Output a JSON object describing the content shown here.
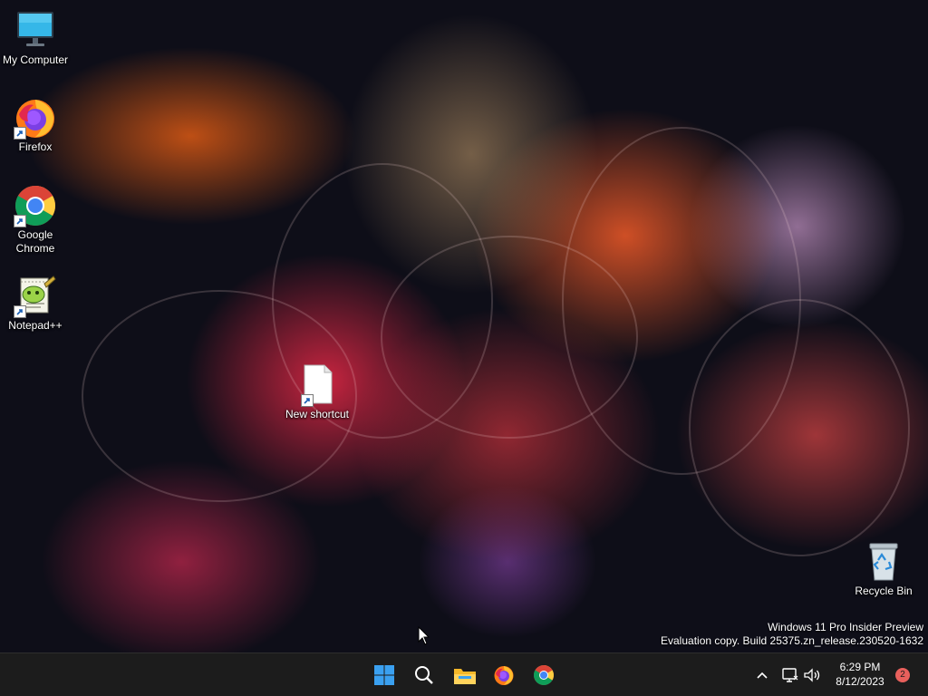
{
  "desktop": {
    "icons": [
      {
        "label": "My Computer",
        "icon": "monitor-icon"
      },
      {
        "label": "Firefox",
        "icon": "firefox-icon"
      },
      {
        "label": "Google Chrome",
        "icon": "chrome-icon"
      },
      {
        "label": "Notepad++",
        "icon": "notepadpp-icon"
      },
      {
        "label": "New shortcut",
        "icon": "blank-file-icon"
      },
      {
        "label": "Recycle Bin",
        "icon": "recycle-bin-icon"
      }
    ],
    "watermark": {
      "line1": "Windows 11 Pro Insider Preview",
      "line2": "Evaluation copy. Build 25375.zn_release.230520-1632"
    }
  },
  "taskbar": {
    "pinned": [
      {
        "name": "Start",
        "icon": "windows-start-icon"
      },
      {
        "name": "Search",
        "icon": "search-icon"
      },
      {
        "name": "File Explorer",
        "icon": "file-explorer-icon"
      },
      {
        "name": "Firefox",
        "icon": "firefox-icon"
      },
      {
        "name": "Google Chrome",
        "icon": "chrome-icon"
      }
    ],
    "tray": {
      "time": "6:29 PM",
      "date": "8/12/2023",
      "notification_count": "2"
    }
  },
  "colors": {
    "taskbar_bg": "#1c1c1c",
    "start_blue": "#3aa0f0",
    "notification_badge": "#e8605c",
    "desktop_bg": "#0e0e18"
  }
}
